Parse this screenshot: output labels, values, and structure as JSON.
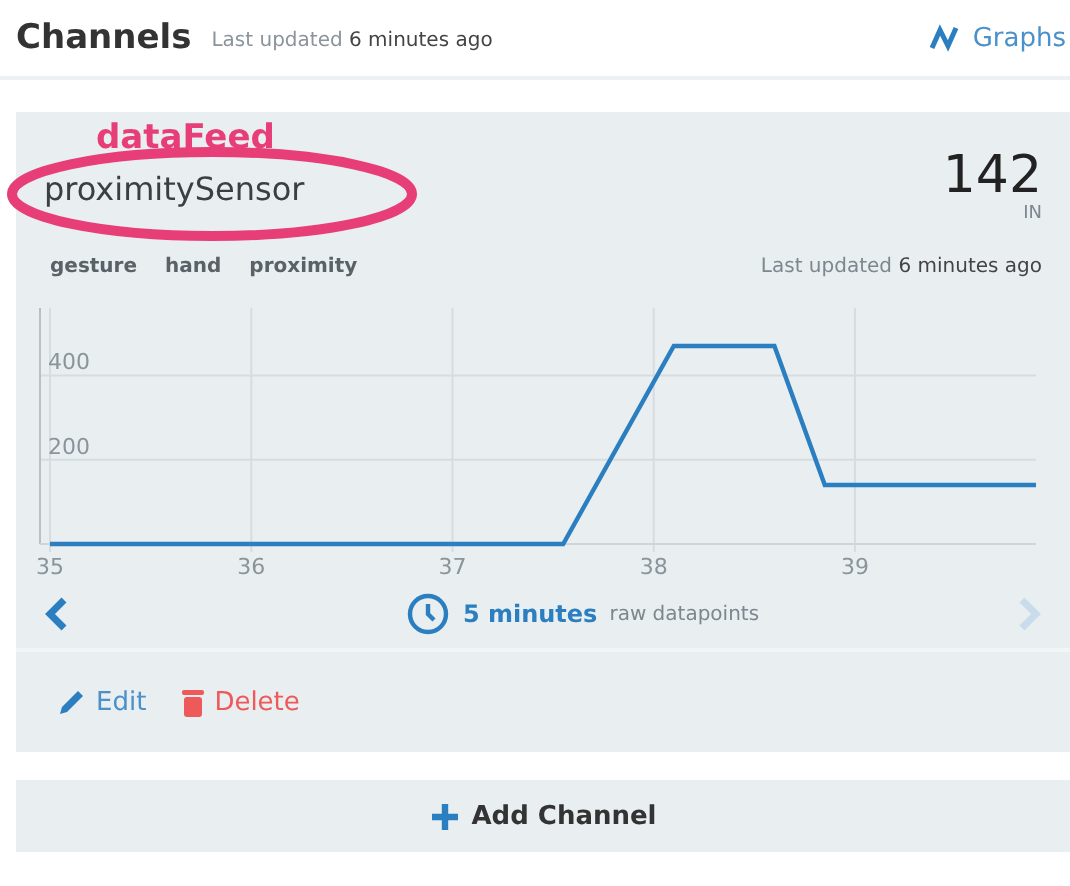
{
  "header": {
    "title": "Channels",
    "updated_label": "Last updated",
    "updated_value": "6 minutes ago",
    "graphs_link": "Graphs"
  },
  "channel": {
    "annotation": "dataFeed",
    "name": "proximitySensor",
    "value": "142",
    "unit": "IN",
    "tags": [
      "gesture",
      "hand",
      "proximity"
    ],
    "updated_label": "Last updated",
    "updated_value": "6 minutes ago",
    "chart_data": {
      "type": "line",
      "x": [
        35,
        37.55,
        38.1,
        38.6,
        38.85,
        39.9
      ],
      "series": [
        {
          "color": "#2b7fc0",
          "values": [
            0,
            0,
            470,
            470,
            140,
            140
          ]
        }
      ],
      "xlim": [
        34.95,
        39.9
      ],
      "ylim": [
        0,
        560
      ],
      "xticks": [
        35,
        36,
        37,
        38,
        39
      ],
      "yticks": [
        200,
        400
      ],
      "grid": true
    },
    "range_value": "5 minutes",
    "range_label": "raw datapoints",
    "prev_disabled": false,
    "next_disabled": true,
    "actions": [
      {
        "kind": "edit",
        "label": "Edit"
      },
      {
        "kind": "delete",
        "label": "Delete"
      }
    ]
  },
  "add_button": "Add Channel"
}
